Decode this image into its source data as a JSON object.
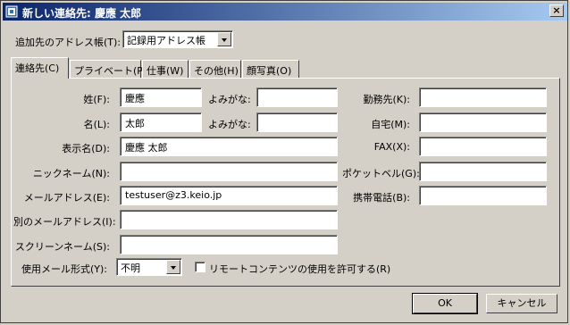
{
  "window": {
    "title": "新しい連絡先: 慶應 太郎",
    "close_glyph": "×"
  },
  "addressbook": {
    "label": "追加先のアドレス帳(T):",
    "value": "記録用アドレス帳"
  },
  "tabs": [
    {
      "label": "連絡先(C)",
      "active": true
    },
    {
      "label": "プライベート(P)"
    },
    {
      "label": "仕事(W)"
    },
    {
      "label": "その他(H)"
    },
    {
      "label": "顔写真(O)"
    }
  ],
  "contact": {
    "last_name_label": "姓(F):",
    "last_name_value": "慶應",
    "reading_label_1": "よみがな:",
    "reading_value_1": "",
    "first_name_label": "名(L):",
    "first_name_value": "太郎",
    "reading_label_2": "よみがな:",
    "reading_value_2": "",
    "display_name_label": "表示名(D):",
    "display_name_value": "慶應 太郎",
    "nickname_label": "ニックネーム(N):",
    "nickname_value": "",
    "email_label": "メールアドレス(E):",
    "email_value": "testuser@z3.keio.jp",
    "alt_email_label": "別のメールアドレス(I):",
    "alt_email_value": "",
    "screen_name_label": "スクリーンネーム(S):",
    "screen_name_value": "",
    "mail_format_label": "使用メール形式(Y):",
    "mail_format_value": "不明",
    "remote_content_label": "リモートコンテンツの使用を許可する(R)",
    "remote_content_checked": false
  },
  "phones": {
    "work_label": "勤務先(K):",
    "work_value": "",
    "home_label": "自宅(M):",
    "home_value": "",
    "fax_label": "FAX(X):",
    "fax_value": "",
    "pager_label": "ポケットベル(G):",
    "pager_value": "",
    "mobile_label": "携帯電話(B):",
    "mobile_value": ""
  },
  "buttons": {
    "ok": "OK",
    "cancel": "キャンセル"
  },
  "icons": {
    "app": "address-book-icon",
    "close": "close-icon",
    "dropdown": "chevron-down-icon"
  }
}
